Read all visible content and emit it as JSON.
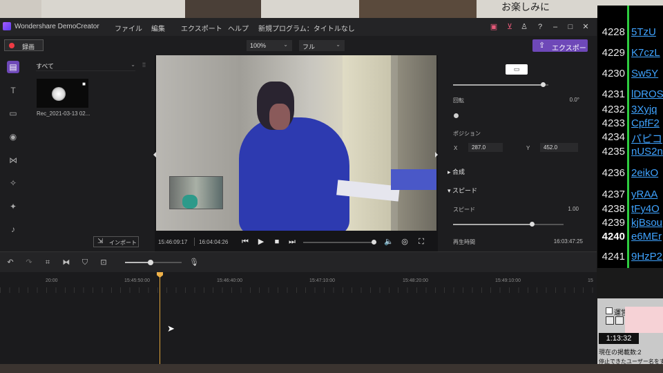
{
  "background": {
    "top_text": "お楽しみに",
    "widget": {
      "checkbox_label": "運営",
      "timer": "1:13:32",
      "line_a": "現在の掲載数:2",
      "line_b": "停止できたユーザー名をすべて"
    },
    "chat_rows": [
      {
        "num": "4228",
        "link": "5TzU"
      },
      {
        "num": "4229",
        "link": "K7czL"
      },
      {
        "num": "4230",
        "link": "Sw5Y"
      },
      {
        "num": "4231",
        "link": "lDROS"
      },
      {
        "num": "4232",
        "link": "3Xyjq"
      },
      {
        "num": "4233",
        "link": "CpfF2"
      },
      {
        "num": "4234",
        "link": "パピコ"
      },
      {
        "num": "4235",
        "link": "nUS2n"
      },
      {
        "num": "4236",
        "link": "2eikO"
      },
      {
        "num": "4237",
        "link": "yRAA"
      },
      {
        "num": "4238",
        "link": "tFy4O"
      },
      {
        "num": "4239",
        "link": "kjBsou"
      },
      {
        "num": "4240",
        "link": "e6MEr"
      },
      {
        "num": "4241",
        "link": "9HzP2"
      }
    ]
  },
  "app": {
    "title": "Wondershare DemoCreator",
    "menu": [
      "ファイル",
      "編集",
      "エクスポート",
      "ヘルプ",
      "新規プログラム：タイトルなし"
    ],
    "record_label": "録画",
    "zoom_value": "100%",
    "quality_value": "フル",
    "export_label": "エクスポート",
    "window_icons": [
      "gift-icon",
      "cart-icon",
      "user-icon",
      "help-icon",
      "minimize-icon",
      "maximize-icon",
      "close-icon"
    ]
  },
  "media": {
    "filter_label": "すべて",
    "clip_name": "Rec_2021-03-13 02...",
    "import_label": "インポート"
  },
  "preview": {
    "current_time": "15:46:09:17",
    "total_time": "16:04:04:26",
    "progress_fraction": 0.97
  },
  "props": {
    "top_slider_fraction": 0.95,
    "rotation_label": "回転",
    "rotation_value": "0.0°",
    "position_label": "ポジション",
    "x_label": "X",
    "x_value": "287.0",
    "y_label": "Y",
    "y_value": "452.0",
    "composite_label": "合成",
    "speed_section_label": "スピード",
    "speed_label": "スピード",
    "speed_value": "1.00",
    "speed_fraction": 0.72,
    "duration_label": "再生時間",
    "duration_value": "16:03:47:25"
  },
  "timeline": {
    "zoom_fraction": 0.45,
    "ticks": [
      "20:00",
      "15:45:50:00",
      "15:46:40:00",
      "15:47:10:00",
      "15:48:20:00",
      "15:49:10:00",
      "15"
    ],
    "playhead_time": "15:46:09:17"
  }
}
